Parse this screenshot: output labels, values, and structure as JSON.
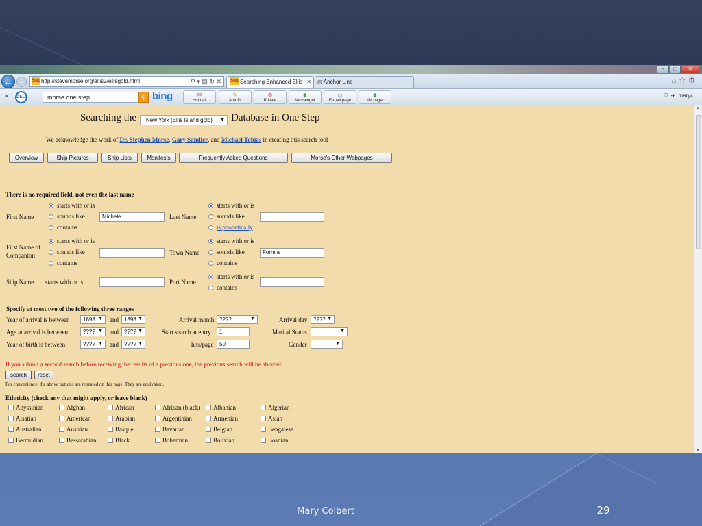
{
  "browser": {
    "url": "http://stevemorse.org/ellis2/ellisgold.html",
    "tabs": [
      {
        "label": "Searching Enhanced Ellis Isl..."
      },
      {
        "label": "Anchor Line"
      }
    ],
    "search_query": "morse one step",
    "search_brand": "bing",
    "toolbar_buttons": [
      "Hotmail",
      "Autofill",
      "Private",
      "Messenger",
      "E-mail page",
      "IM page"
    ],
    "user_label": "maryc...",
    "favicon_text": "Step"
  },
  "page": {
    "heading_left": "Searching the",
    "heading_right": "Database in One Step",
    "database_selected": "New York (Ellis Island gold)",
    "ack": {
      "prefix": "We acknowledge the work of",
      "person1": "Dr. Stephen Morse",
      "sep1": ",",
      "person2": "Gary Sandler",
      "sep2": ", and",
      "person3": "Michael Tobias",
      "suffix": "in creating this search tool"
    },
    "nav_buttons": [
      "Overview",
      "Ship Pictures",
      "Ship Lists",
      "Manifests",
      "Frequently Asked Questions",
      "Morse's Other Webpages"
    ],
    "no_required": "There is no required field, not even the last name",
    "options": {
      "starts_with": "starts with or is",
      "sounds_like": "sounds like",
      "contains": "contains",
      "phonetically": "is phonetically"
    },
    "labels": {
      "first_name": "First Name",
      "last_name": "Last Name",
      "companion_1": "First Name of",
      "companion_2": "Companion",
      "town_name": "Town Name",
      "ship_name": "Ship Name",
      "ship_starts": "starts with or is",
      "port_name": "Port Name"
    },
    "values": {
      "first_name": "Michele",
      "last_name": "",
      "companion": "",
      "town": "Formia",
      "ship": "",
      "port": ""
    },
    "ranges_title": "Specify at most two of the following three ranges",
    "ranges": {
      "year_arrival": "Year of arrival is between",
      "age_arrival": "Age at arrival is between",
      "year_birth": "Year of birth is between",
      "and": "and",
      "year_arrival_from": "1898",
      "year_arrival_to": "1898",
      "age_from": "????",
      "age_to": "????",
      "birth_from": "????",
      "birth_to": "????",
      "arrival_month_label": "Arrival month",
      "arrival_month": "????",
      "start_entry_label": "Start search at entry",
      "start_entry": "1",
      "hits_label": "hits/page",
      "hits": "50",
      "arrival_day_label": "Arrival day",
      "arrival_day": "????",
      "marital_label": "Marital Status",
      "marital": "",
      "gender_label": "Gender",
      "gender": ""
    },
    "warning": "If you submit a second search before receiving the results of a previous one, the previous search will be aborted.",
    "search_button": "search",
    "reset_button": "reset",
    "convenience": "For convenience, the above buttons are repeated on this page. They are equivalent.",
    "ethnicity_title": "Ethnicity (check any that might apply, or leave blank)",
    "ethnicity": [
      [
        "Abyssinian",
        "Afghan",
        "African",
        "African (black)",
        "Albanian",
        "Algerian"
      ],
      [
        "Alsatian",
        "American",
        "Arabian",
        "Argentinian",
        "Armenian",
        "Asian"
      ],
      [
        "Australian",
        "Austrian",
        "Basque",
        "Bavarian",
        "Belgian",
        "Bengalese"
      ],
      [
        "Bermudian",
        "Bessarabian",
        "Black",
        "Bohemian",
        "Bolivian",
        "Bosnian"
      ]
    ]
  },
  "slide": {
    "footer": "Mary Colbert",
    "number": "29"
  }
}
